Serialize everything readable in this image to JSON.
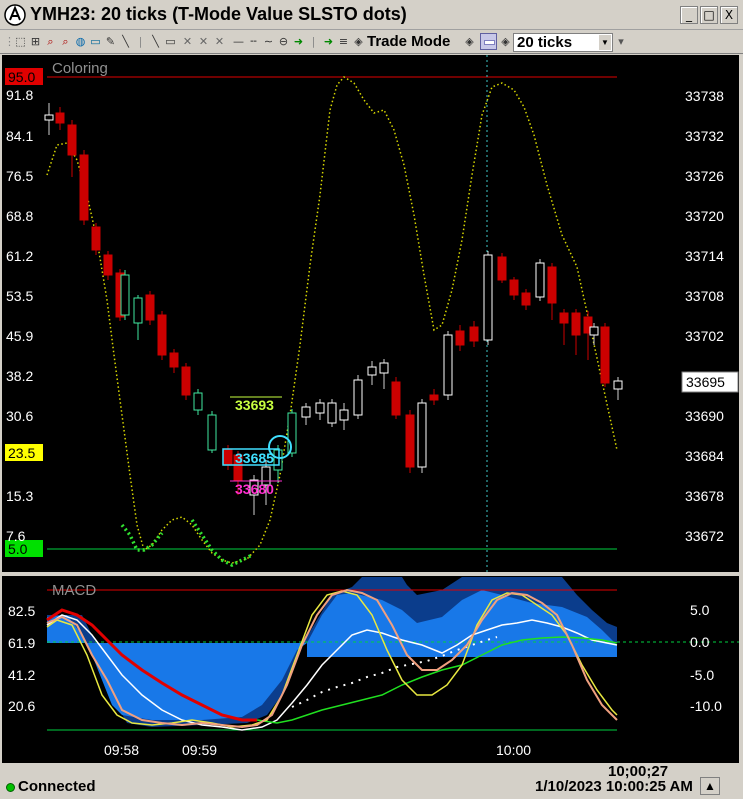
{
  "window": {
    "title": "YMH23: 20 ticks (T-Mode Value SLSTO dots)",
    "buttons": [
      "_",
      "□",
      "X"
    ]
  },
  "toolbar": {
    "trade_mode_label": "Trade Mode",
    "interval_value": "20 ticks",
    "icons": [
      "select-icon",
      "zoom-icon",
      "magnifier-icon",
      "pan-icon",
      "pencil-icon",
      "line-icon",
      "rectangle-icon",
      "cross-icon",
      "horizontal-line-icon",
      "arrow-icon",
      "fibonacci-icon"
    ]
  },
  "upper_panel": {
    "indicator_label": "Coloring",
    "left_axis": [
      "91.8",
      "84.1",
      "76.5",
      "68.8",
      "61.2",
      "53.5",
      "45.9",
      "38.2",
      "30.6",
      "15.3",
      "7.6"
    ],
    "left_badges": [
      {
        "text": "95.0",
        "color": "#e00000"
      },
      {
        "text": "23.5",
        "color": "#ffff00"
      },
      {
        "text": "5.0",
        "color": "#00e000"
      }
    ],
    "right_axis": [
      "33738",
      "33732",
      "33726",
      "33720",
      "33714",
      "33708",
      "33702",
      "33690",
      "33684",
      "33678",
      "33672"
    ],
    "price_badge": "33695",
    "annotations": [
      {
        "text": "33693",
        "color": "#c8ff40"
      },
      {
        "text": "33685",
        "color": "#40e0ff"
      },
      {
        "text": "33680",
        "color": "#ff30d0"
      }
    ]
  },
  "lower_panel": {
    "indicator_label": "MACD",
    "left_axis": [
      "82.5",
      "61.9",
      "41.2",
      "20.6"
    ],
    "right_axis": [
      "5.0",
      "0.0",
      "-5.0",
      "-10.0"
    ],
    "time_labels": [
      "09:58",
      "09:59",
      "10:00"
    ]
  },
  "statusbar": {
    "clock": "10;00;27",
    "connection": "Connected",
    "datetime": "1/10/2023 10:00:25 AM"
  },
  "colors": {
    "up_candle_outline": "#40e8a0",
    "down_candle": "#cc0000",
    "neutral_candle": "#ffffff",
    "stoch_line": "#e8e800",
    "stoch_dots_green": "#30e030",
    "overbought_line": "#e00000",
    "oversold_line": "#00d040"
  },
  "chart_data": [
    {
      "type": "line",
      "name": "upper-stochastic-panel",
      "title": "Coloring",
      "left_axis_range": [
        5.0,
        95.0
      ],
      "right_axis_range": [
        33672,
        33738
      ],
      "last_price": 33695
    },
    {
      "type": "area",
      "name": "macd-panel",
      "title": "MACD",
      "left_axis_range": [
        20.6,
        82.5
      ],
      "right_axis_range": [
        -10.0,
        5.0
      ],
      "x_labels": [
        "09:58",
        "09:59",
        "10:00"
      ]
    }
  ]
}
